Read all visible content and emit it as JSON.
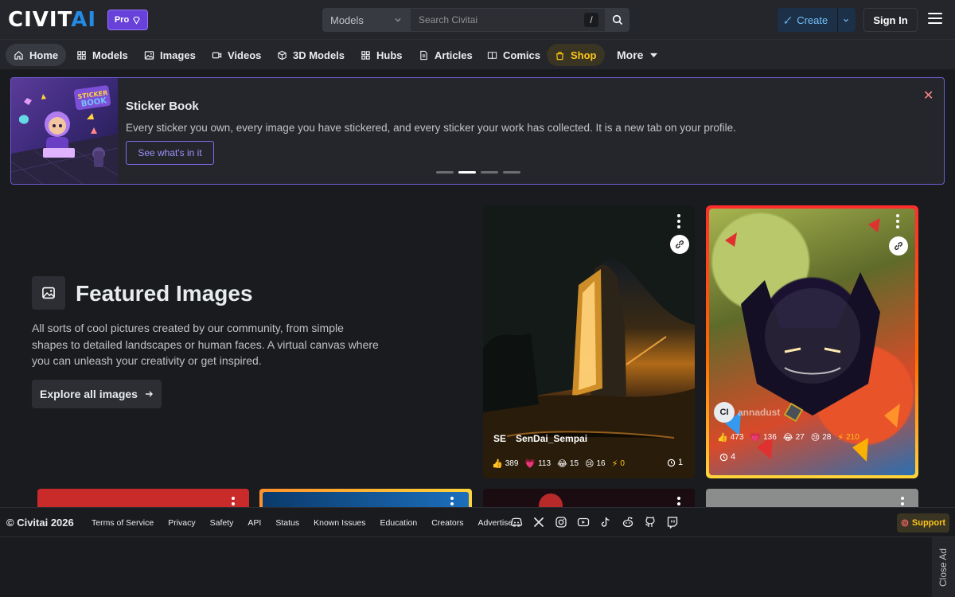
{
  "header": {
    "logo": "CIVIT",
    "logo_accent": "AI",
    "pro_label": "Pro",
    "search_type": "Models",
    "search_placeholder": "Search Civitai",
    "search_shortcut": "/",
    "create_label": "Create",
    "signin_label": "Sign In"
  },
  "nav": {
    "items": [
      {
        "label": "Home",
        "icon": "home-icon"
      },
      {
        "label": "Models",
        "icon": "grid-icon"
      },
      {
        "label": "Images",
        "icon": "image-icon"
      },
      {
        "label": "Videos",
        "icon": "video-icon"
      },
      {
        "label": "3D Models",
        "icon": "cube-icon"
      },
      {
        "label": "Hubs",
        "icon": "grid-icon"
      },
      {
        "label": "Articles",
        "icon": "file-icon"
      },
      {
        "label": "Comics",
        "icon": "book-icon"
      },
      {
        "label": "Shop",
        "icon": "bag-icon"
      },
      {
        "label": "More",
        "icon": "caret-down-icon"
      }
    ]
  },
  "banner": {
    "title": "Sticker Book",
    "description": "Every sticker you own, every image you have stickered, and every sticker your work has collected. It is a new tab on your profile.",
    "cta": "See what's in it",
    "image_text": "STICKER BOOK"
  },
  "featured": {
    "title": "Featured Images",
    "description": "All sorts of cool pictures created by our community, from simple shapes to detailed landscapes or human faces. A virtual canvas where you can unleash your creativity or get inspired.",
    "button": "Explore all images"
  },
  "cards": [
    {
      "user_initials": "SE",
      "username": "SenDai_Sempai",
      "likes": "389",
      "hearts": "113",
      "laughs": "15",
      "cries": "16",
      "buzz": "0",
      "comments": "1"
    },
    {
      "user_initials": "CI",
      "username": "annadust",
      "likes": "473",
      "hearts": "136",
      "laughs": "27",
      "cries": "28",
      "buzz": "210",
      "comments": "4"
    }
  ],
  "footer": {
    "copyright": "© Civitai 2026",
    "links": [
      "Terms of Service",
      "Privacy",
      "Safety",
      "API",
      "Status",
      "Known Issues",
      "Education",
      "Creators",
      "Advertise"
    ],
    "support": "Support",
    "close_ad": "Close Ad"
  },
  "colors": {
    "background": "#1a1b1e",
    "panel": "#25262b",
    "accent_blue": "#228be6",
    "accent_purple": "#6741d9",
    "shop_gold": "#fcc419"
  }
}
